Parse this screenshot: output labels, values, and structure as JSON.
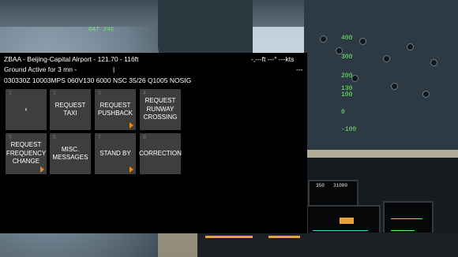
{
  "hud": {
    "oat": "OAT 24C",
    "scale": [
      "400",
      "300",
      "200",
      "130",
      "100",
      "0",
      "-100"
    ]
  },
  "panel": {
    "readout_left": "350",
    "readout_right": "31000"
  },
  "atc": {
    "airport": "ZBAA - Beijing-Capital Airport - 121.70 - 116ft",
    "altitude_readout": "-,---ft  ---° ---kts",
    "status": "Ground Active for 3 mn -",
    "status_marker": "|",
    "status_right": "---",
    "metar": "030330Z 10003MPS 060V130 6000 NSC 35/26 Q1005 NOSIG",
    "buttons": [
      {
        "num": "1",
        "label": "‹",
        "submenu": false
      },
      {
        "num": "2",
        "label": "REQUEST TAXI",
        "submenu": false
      },
      {
        "num": "3",
        "label": "REQUEST PUSHBACK",
        "submenu": true
      },
      {
        "num": "4",
        "label": "REQUEST RUNWAY CROSSING",
        "submenu": false
      },
      {
        "num": "5",
        "label": "REQUEST FREQUENCY CHANGE",
        "submenu": true
      },
      {
        "num": "6",
        "label": "MISC. MESSAGES",
        "submenu": false
      },
      {
        "num": "7",
        "label": "STAND BY",
        "submenu": true
      },
      {
        "num": "8",
        "label": "CORRECTION",
        "submenu": false
      }
    ]
  }
}
